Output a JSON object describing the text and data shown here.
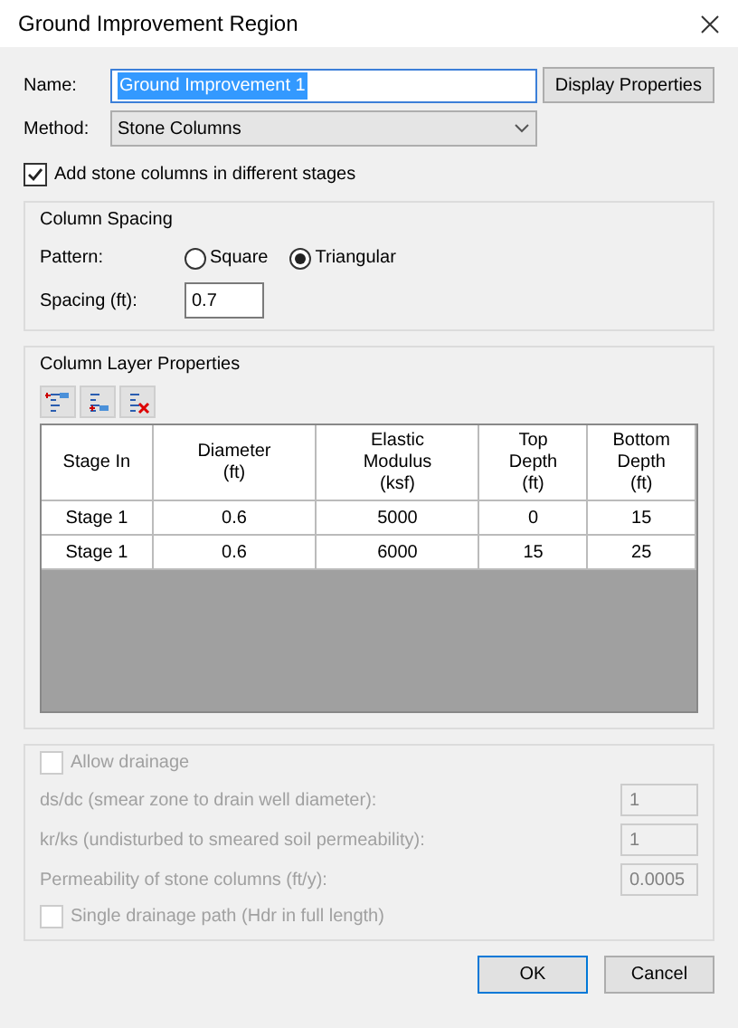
{
  "window": {
    "title": "Ground Improvement Region"
  },
  "name": {
    "label": "Name:",
    "value": "Ground Improvement 1",
    "selected": true
  },
  "display_button": "Display Properties",
  "method": {
    "label": "Method:",
    "value": "Stone Columns"
  },
  "stages_checkbox": {
    "label": "Add stone columns in different stages",
    "checked": true
  },
  "column_spacing": {
    "title": "Column Spacing",
    "pattern_label": "Pattern:",
    "options": [
      {
        "label": "Square",
        "selected": false
      },
      {
        "label": "Triangular",
        "selected": true
      }
    ],
    "spacing_label": "Spacing (ft):",
    "spacing_value": "0.7"
  },
  "column_layers": {
    "title": "Column Layer Properties",
    "toolbar": [
      {
        "kind": "insert"
      },
      {
        "kind": "append"
      },
      {
        "kind": "delete"
      }
    ],
    "columns": [
      "Stage In",
      "Diameter\n(ft)",
      "Elastic\nModulus\n(ksf)",
      "Top\nDepth\n(ft)",
      "Bottom\nDepth\n(ft)"
    ],
    "rows": [
      [
        "Stage 1",
        "0.6",
        "5000",
        "0",
        "15"
      ],
      [
        "Stage 1",
        "0.6",
        "6000",
        "15",
        "25"
      ]
    ]
  },
  "drainage": {
    "label": "Allow drainage",
    "checked": false,
    "disabled": true,
    "fields": [
      {
        "label": "ds/dc (smear zone to drain well diameter):",
        "value": "1"
      },
      {
        "label": "kr/ks (undisturbed to smeared soil permeability):",
        "value": "1"
      },
      {
        "label": "Permeability of stone columns (ft/y):",
        "value": "0.0005"
      }
    ],
    "single_path": {
      "label": "Single drainage path (Hdr in full length)",
      "checked": false
    }
  },
  "buttons": [
    {
      "label": "OK",
      "kind": "default"
    },
    {
      "label": "Cancel",
      "kind": "normal"
    }
  ]
}
